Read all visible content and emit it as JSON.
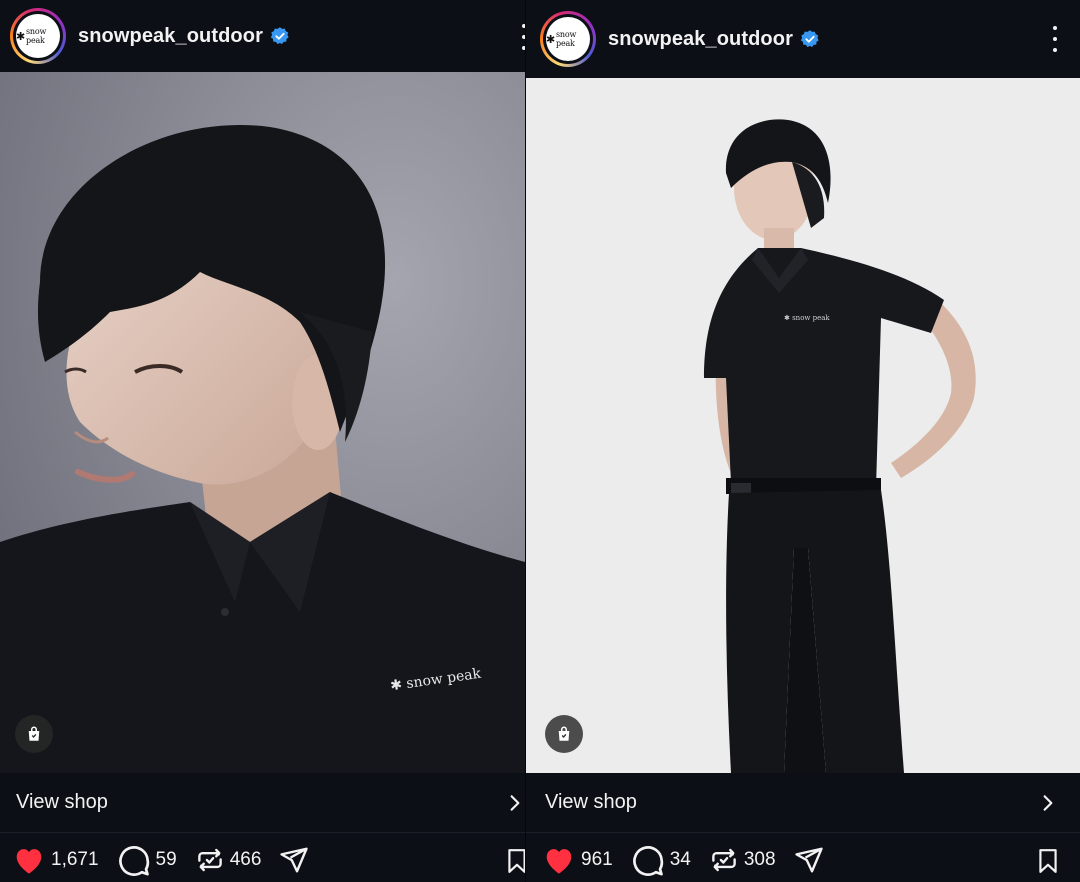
{
  "posts": [
    {
      "username": "snowpeak_outdoor",
      "avatar_logo": "snow peak",
      "verified": true,
      "shirt_logo": "snow peak",
      "view_shop_label": "View shop",
      "likes": "1,671",
      "comments": "59",
      "reposts": "466",
      "icons": [
        "verified-badge-icon",
        "more-options-icon",
        "shopping-bag-icon",
        "chevron-right-icon",
        "heart-icon",
        "comment-icon",
        "repost-icon",
        "share-icon",
        "bookmark-icon"
      ]
    },
    {
      "username": "snowpeak_outdoor",
      "avatar_logo": "snow peak",
      "verified": true,
      "shirt_logo": "snow peak",
      "view_shop_label": "View shop",
      "likes": "961",
      "comments": "34",
      "reposts": "308",
      "icons": [
        "verified-badge-icon",
        "more-options-icon",
        "shopping-bag-icon",
        "chevron-right-icon",
        "heart-icon",
        "comment-icon",
        "repost-icon",
        "share-icon",
        "bookmark-icon"
      ]
    }
  ],
  "colors": {
    "background": "#0c0f15",
    "verified_blue": "#3897f0",
    "like_red": "#ff3040",
    "text": "#f2f2f2"
  }
}
